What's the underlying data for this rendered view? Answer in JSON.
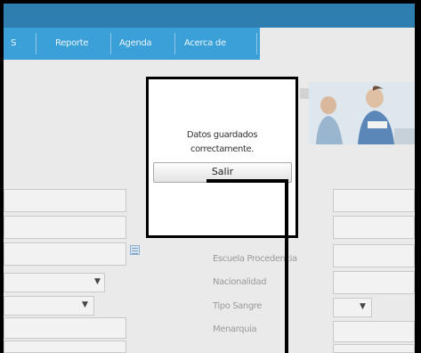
{
  "nav": {
    "items": [
      {
        "label": "S"
      },
      {
        "label": "Reporte"
      },
      {
        "label": "Agenda"
      },
      {
        "label": "Acerca de"
      }
    ]
  },
  "form": {
    "labels": {
      "school": "Escuela Procedencia",
      "nationality": "Nacionalidad",
      "blood_type": "Tipo Sangre",
      "menarche": "Menarquia"
    },
    "select_arrow": "▼"
  },
  "dialog": {
    "message_line1": "Datos guardados",
    "message_line2": "correctamente.",
    "button_label": "Salir"
  },
  "colors": {
    "topbar": "#2e7fb0",
    "nav": "#3aa0d7",
    "page_bg": "#eaeaea"
  }
}
